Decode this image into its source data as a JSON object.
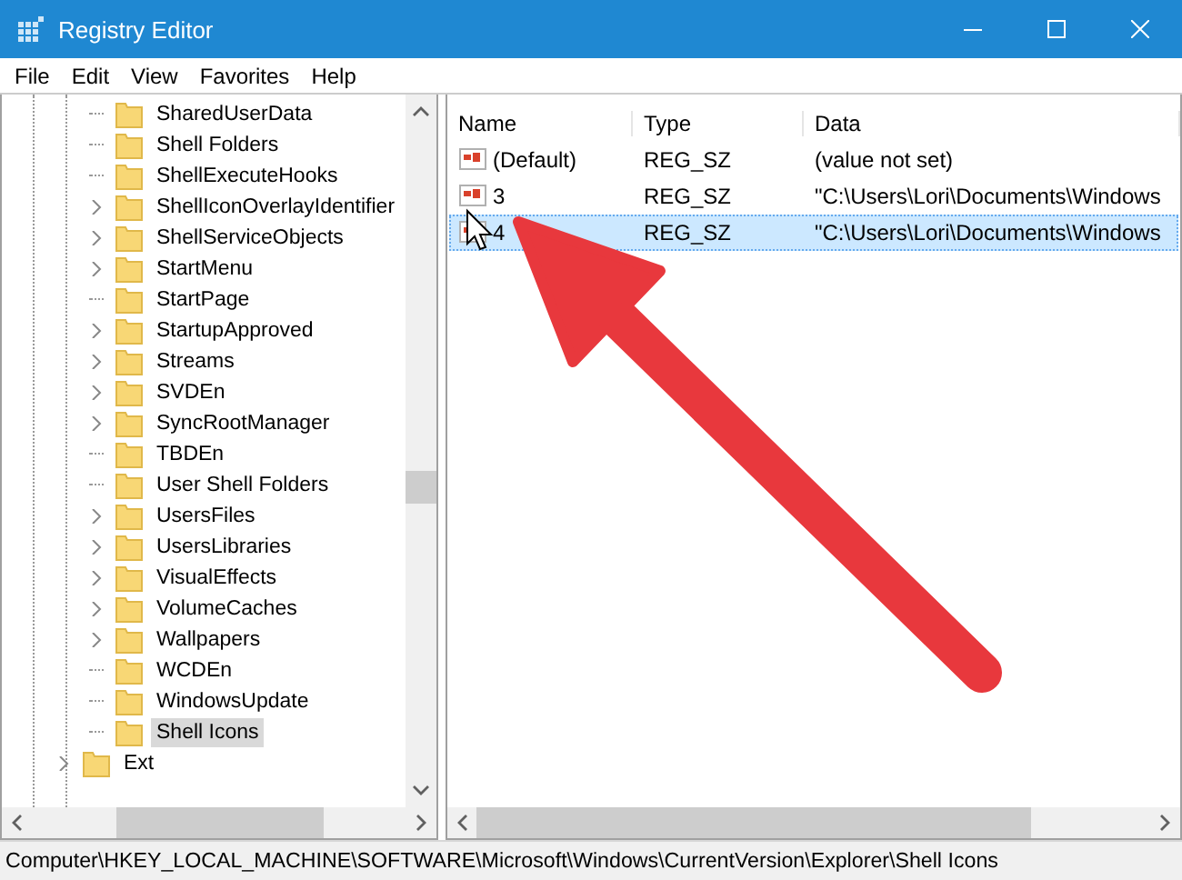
{
  "window": {
    "title": "Registry Editor"
  },
  "menu": [
    "File",
    "Edit",
    "View",
    "Favorites",
    "Help"
  ],
  "tree": {
    "explorer_children": [
      {
        "label": "SharedUserData",
        "expandable": false,
        "selected": false
      },
      {
        "label": "Shell Folders",
        "expandable": false,
        "selected": false
      },
      {
        "label": "ShellExecuteHooks",
        "expandable": false,
        "selected": false
      },
      {
        "label": "ShellIconOverlayIdentifier",
        "expandable": true,
        "selected": false
      },
      {
        "label": "ShellServiceObjects",
        "expandable": true,
        "selected": false
      },
      {
        "label": "StartMenu",
        "expandable": true,
        "selected": false
      },
      {
        "label": "StartPage",
        "expandable": false,
        "selected": false
      },
      {
        "label": "StartupApproved",
        "expandable": true,
        "selected": false
      },
      {
        "label": "Streams",
        "expandable": true,
        "selected": false
      },
      {
        "label": "SVDEn",
        "expandable": true,
        "selected": false
      },
      {
        "label": "SyncRootManager",
        "expandable": true,
        "selected": false
      },
      {
        "label": "TBDEn",
        "expandable": false,
        "selected": false
      },
      {
        "label": "User Shell Folders",
        "expandable": false,
        "selected": false
      },
      {
        "label": "UsersFiles",
        "expandable": true,
        "selected": false
      },
      {
        "label": "UsersLibraries",
        "expandable": true,
        "selected": false
      },
      {
        "label": "VisualEffects",
        "expandable": true,
        "selected": false
      },
      {
        "label": "VolumeCaches",
        "expandable": true,
        "selected": false
      },
      {
        "label": "Wallpapers",
        "expandable": true,
        "selected": false
      },
      {
        "label": "WCDEn",
        "expandable": false,
        "selected": false
      },
      {
        "label": "WindowsUpdate",
        "expandable": false,
        "selected": false
      },
      {
        "label": "Shell Icons",
        "expandable": false,
        "selected": true
      }
    ],
    "after_explorer": [
      {
        "label": "Ext",
        "expandable": true,
        "selected": false
      }
    ]
  },
  "values": {
    "columns": [
      "Name",
      "Type",
      "Data"
    ],
    "rows": [
      {
        "name": "(Default)",
        "type": "REG_SZ",
        "data": "(value not set)",
        "selected": false
      },
      {
        "name": "3",
        "type": "REG_SZ",
        "data": "\"C:\\Users\\Lori\\Documents\\Windows",
        "selected": false
      },
      {
        "name": "4",
        "type": "REG_SZ",
        "data": "\"C:\\Users\\Lori\\Documents\\Windows",
        "selected": true
      }
    ]
  },
  "status_bar": "Computer\\HKEY_LOCAL_MACHINE\\SOFTWARE\\Microsoft\\Windows\\CurrentVersion\\Explorer\\Shell Icons"
}
